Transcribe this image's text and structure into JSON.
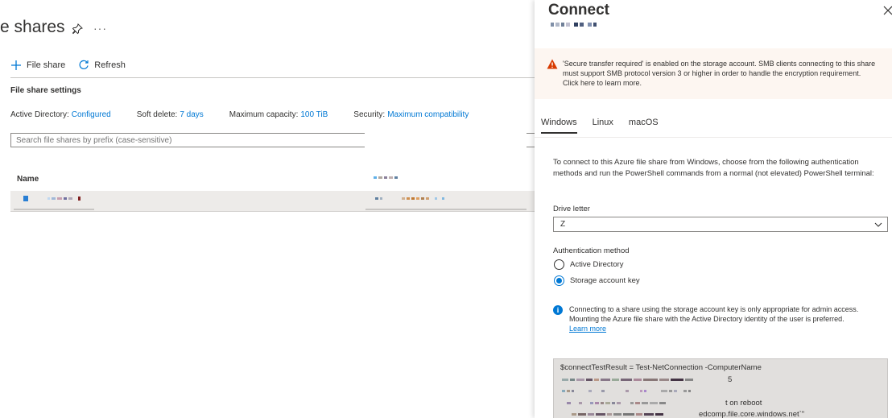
{
  "page": {
    "title": "e shares",
    "more_label": "···"
  },
  "toolbar": {
    "file_share_label": "File share",
    "refresh_label": "Refresh"
  },
  "settings": {
    "section_title": "File share settings",
    "active_directory_label": "Active Directory:",
    "active_directory_value": "Configured",
    "soft_delete_label": "Soft delete:",
    "soft_delete_value": "7 days",
    "max_capacity_label": "Maximum capacity:",
    "max_capacity_value": "100 TiB",
    "security_label": "Security:",
    "security_value": "Maximum compatibility"
  },
  "search": {
    "placeholder": "Search file shares by prefix (case-sensitive)"
  },
  "table": {
    "columns": [
      "Name"
    ]
  },
  "panel": {
    "title": "Connect",
    "warning": "'Secure transfer required' is enabled on the storage account. SMB clients connecting to this share must support SMB protocol version 3 or higher in order to handle the encryption requirement. Click here to learn more.",
    "tabs": [
      "Windows",
      "Linux",
      "macOS"
    ],
    "intro": "To connect to this Azure file share from Windows, choose from the following authentication methods and run the PowerShell commands from a normal (not elevated) PowerShell terminal:",
    "drive_letter_label": "Drive letter",
    "drive_letter_value": "Z",
    "auth_method_label": "Authentication method",
    "auth_options": [
      "Active Directory",
      "Storage account key"
    ],
    "auth_selected": "Storage account key",
    "info_text": "Connecting to a share using the storage account key is only appropriate for admin access. Mounting the Azure file share with the Active Directory identity of the user is preferred.",
    "info_link": "Learn more",
    "code": {
      "line1": "$connectTestResult = Test-NetConnection -ComputerName",
      "line2_suffix": "5",
      "line4_suffix": "t on reboot",
      "line5_suffix": "edcomp.file.core.windows.net`\""
    }
  },
  "colors": {
    "accent": "#0078d4",
    "warning_bg": "#fdf6f1",
    "warning_icon": "#d83b01",
    "code_bg": "#e1dfdd"
  }
}
